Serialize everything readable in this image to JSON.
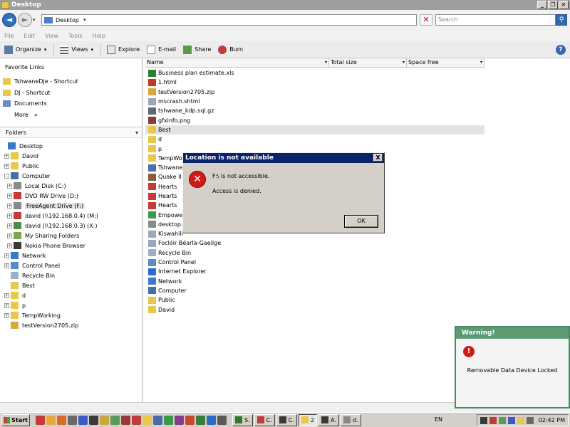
{
  "window": {
    "title": "Desktop"
  },
  "address": {
    "location": "Desktop",
    "search_placeholder": "Search"
  },
  "menu": [
    "File",
    "Edit",
    "View",
    "Tools",
    "Help"
  ],
  "toolbar": {
    "organize": "Organize",
    "views": "Views",
    "explore": "Explore",
    "email": "E-mail",
    "share": "Share",
    "burn": "Burn"
  },
  "favorites": {
    "title": "Favorite Links",
    "items": [
      "TshwaneDJe - Shortcut",
      "DJ - Shortcut",
      "Documents",
      "More"
    ],
    "more_glyph": "»"
  },
  "folders": {
    "title": "Folders",
    "tree": [
      {
        "label": "Desktop",
        "indent": 0,
        "expander": "",
        "icon": "desktop-icon",
        "color": "#3a78c9"
      },
      {
        "label": "David",
        "indent": 1,
        "expander": "+",
        "icon": "user-folder-icon",
        "color": "#e8c74a"
      },
      {
        "label": "Public",
        "indent": 1,
        "expander": "+",
        "icon": "folder-icon",
        "color": "#e8c74a"
      },
      {
        "label": "Computer",
        "indent": 1,
        "expander": "-",
        "icon": "computer-icon",
        "color": "#4a6fa8"
      },
      {
        "label": "Local Disk (C:)",
        "indent": 2,
        "expander": "+",
        "icon": "drive-icon",
        "color": "#8a8a8a"
      },
      {
        "label": "DVD RW Drive (D:)",
        "indent": 2,
        "expander": "+",
        "icon": "dvd-icon",
        "color": "#c23a3a"
      },
      {
        "label": "FreeAgent Drive (F:)",
        "indent": 2,
        "expander": "+",
        "icon": "drive-icon",
        "color": "#8a8a8a",
        "selected": true
      },
      {
        "label": "david (\\\\192.168.0.4) (M:)",
        "indent": 2,
        "expander": "+",
        "icon": "network-drive-icon",
        "color": "#c23a3a"
      },
      {
        "label": "david (\\\\192.168.0.3) (X:)",
        "indent": 2,
        "expander": "+",
        "icon": "network-drive-icon",
        "color": "#4a8a4a"
      },
      {
        "label": "My Sharing Folders",
        "indent": 2,
        "expander": "+",
        "icon": "sharing-icon",
        "color": "#7aa84a"
      },
      {
        "label": "Nokia Phone Browser",
        "indent": 2,
        "expander": "+",
        "icon": "phone-icon",
        "color": "#3a3a3a"
      },
      {
        "label": "Network",
        "indent": 1,
        "expander": "+",
        "icon": "network-icon",
        "color": "#3a78c9"
      },
      {
        "label": "Control Panel",
        "indent": 1,
        "expander": "+",
        "icon": "control-panel-icon",
        "color": "#5a8ac9"
      },
      {
        "label": "Recycle Bin",
        "indent": 1,
        "expander": "",
        "icon": "recycle-bin-icon",
        "color": "#9ab0c8"
      },
      {
        "label": "Best",
        "indent": 1,
        "expander": "",
        "icon": "folder-icon",
        "color": "#e8c74a"
      },
      {
        "label": "d",
        "indent": 1,
        "expander": "+",
        "icon": "folder-icon",
        "color": "#e8c74a"
      },
      {
        "label": "p",
        "indent": 1,
        "expander": "+",
        "icon": "folder-icon",
        "color": "#e8c74a"
      },
      {
        "label": "TempWorking",
        "indent": 1,
        "expander": "+",
        "icon": "folder-icon",
        "color": "#e8c74a"
      },
      {
        "label": "testVersion2705.zip",
        "indent": 1,
        "expander": "",
        "icon": "zip-icon",
        "color": "#d8a83a"
      }
    ]
  },
  "columns": [
    "Name",
    "Total size",
    "Space free"
  ],
  "files": [
    {
      "name": "Business plan estimate.xls",
      "icon": "excel-icon",
      "color": "#2e7d32"
    },
    {
      "name": "1.html",
      "icon": "html-icon",
      "color": "#c0392b"
    },
    {
      "name": "testVersion2705.zip",
      "icon": "zip-icon",
      "color": "#d8a83a"
    },
    {
      "name": "mscrash.shtml",
      "icon": "document-icon",
      "color": "#9aa8b8"
    },
    {
      "name": "tshwane_kdp.sql.gz",
      "icon": "archive-icon",
      "color": "#5a6a7a"
    },
    {
      "name": "gfxinfo.png",
      "icon": "image-icon",
      "color": "#8a3a3a"
    },
    {
      "name": "Best",
      "icon": "folder-icon",
      "color": "#e8c74a",
      "selected": true
    },
    {
      "name": "d",
      "icon": "folder-icon",
      "color": "#e8c74a"
    },
    {
      "name": "p",
      "icon": "folder-icon",
      "color": "#e8c74a"
    },
    {
      "name": "TempWo",
      "icon": "folder-icon",
      "color": "#e8c74a"
    },
    {
      "name": "Tshwane",
      "icon": "shortcut-icon",
      "color": "#4a6fa8"
    },
    {
      "name": "Quake II",
      "icon": "game-icon",
      "color": "#8a5a3a"
    },
    {
      "name": "Hearts",
      "icon": "game-icon",
      "color": "#c23a3a"
    },
    {
      "name": "Hearts",
      "icon": "game-icon",
      "color": "#c23a3a"
    },
    {
      "name": "Hearts",
      "icon": "game-icon",
      "color": "#c23a3a"
    },
    {
      "name": "Empowe",
      "icon": "app-icon",
      "color": "#3a9a4a"
    },
    {
      "name": "desktop.",
      "icon": "settings-file-icon",
      "color": "#8a8a8a"
    },
    {
      "name": "Kiswahili",
      "icon": "document-icon",
      "color": "#9aa8b8"
    },
    {
      "name": "Foclóir Béarla-Gaeilge",
      "icon": "document-icon",
      "color": "#9aa8b8"
    },
    {
      "name": "Recycle Bin",
      "icon": "recycle-bin-icon",
      "color": "#9ab0c8"
    },
    {
      "name": "Control Panel",
      "icon": "control-panel-icon",
      "color": "#5a8ac9"
    },
    {
      "name": "Internet Explorer",
      "icon": "ie-icon",
      "color": "#2a6ac9"
    },
    {
      "name": "Network",
      "icon": "network-icon",
      "color": "#3a78c9"
    },
    {
      "name": "Computer",
      "icon": "computer-icon",
      "color": "#4a6fa8"
    },
    {
      "name": "Public",
      "icon": "folder-icon",
      "color": "#e8c74a"
    },
    {
      "name": "David",
      "icon": "user-folder-icon",
      "color": "#e8c74a"
    }
  ],
  "dialog": {
    "title": "Location is not available",
    "message": "F:\\ is not accessible.",
    "detail": "Access is denied.",
    "ok": "OK",
    "close": "X"
  },
  "warning": {
    "title": "Warning!",
    "message": "Removable Data Device Locked"
  },
  "taskbar": {
    "start": "Start",
    "tasks": [
      {
        "label": "S.",
        "color": "#2a7a2a"
      },
      {
        "label": "C.",
        "color": "#c23a3a"
      },
      {
        "label": "C.",
        "color": "#3a3a3a"
      },
      {
        "label": "2",
        "color": "#e8c74a",
        "active": true
      },
      {
        "label": "A.",
        "color": "#3a3a3a"
      },
      {
        "label": "d.",
        "color": "#8a8a8a"
      }
    ],
    "lang": "EN",
    "clock": "02:42 PM"
  }
}
